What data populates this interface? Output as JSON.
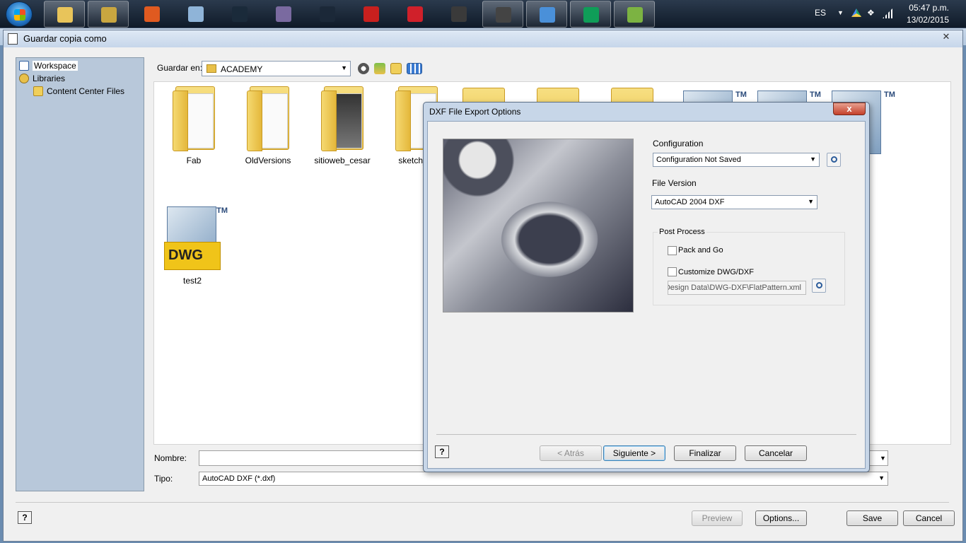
{
  "taskbar": {
    "apps": [
      {
        "name": "explorer",
        "color": "#e8c45a"
      },
      {
        "name": "inventor",
        "color": "#c9a640"
      },
      {
        "name": "matlab",
        "color": "#e05a20"
      },
      {
        "name": "atom",
        "color": "#8fb4d8"
      },
      {
        "name": "p-app",
        "color": "#1a2a3a"
      },
      {
        "name": "equalizer",
        "color": "#7a6aa0"
      },
      {
        "name": "steam",
        "color": "#1b2838"
      },
      {
        "name": "autocad",
        "color": "#c8201e"
      },
      {
        "name": "mplab",
        "color": "#d0202a"
      },
      {
        "name": "sublime",
        "color": "#3a3a3a"
      },
      {
        "name": "inkscape",
        "color": "#444"
      },
      {
        "name": "chrome",
        "color": "#4a90d9"
      },
      {
        "name": "hangouts",
        "color": "#0f9d58"
      },
      {
        "name": "green-app",
        "color": "#7cb342"
      }
    ],
    "lang": "ES",
    "time": "05:47 p.m.",
    "date": "13/02/2015"
  },
  "main": {
    "title": "Guardar copia como",
    "close_label": "✕",
    "sidebar": {
      "items": [
        {
          "label": "Workspace"
        },
        {
          "label": "Libraries"
        },
        {
          "label": "Content Center Files"
        }
      ]
    },
    "lookin_label": "Guardar en:",
    "lookin_value": "ACADEMY",
    "files": [
      {
        "name": "Fab",
        "kind": "folder"
      },
      {
        "name": "OldVersions",
        "kind": "folder"
      },
      {
        "name": "sitioweb_cesar",
        "kind": "folder"
      },
      {
        "name": "sketch_fe",
        "kind": "folder"
      },
      {
        "name": "test2",
        "kind": "dwg"
      }
    ],
    "dwg_text": "DWG",
    "dwg_tm": "TM",
    "name_label": "Nombre:",
    "name_value": "",
    "type_label": "Tipo:",
    "type_value": "AutoCAD DXF (*.dxf)",
    "help_label": "?",
    "buttons": {
      "preview": "Preview",
      "options": "Options...",
      "save": "Save",
      "cancel": "Cancel"
    }
  },
  "dxf": {
    "title": "DXF File Export Options",
    "close_label": "x",
    "configuration_label": "Configuration",
    "configuration_value": "Configuration Not Saved",
    "file_version_label": "File Version",
    "file_version_value": "AutoCAD 2004 DXF",
    "post_process_label": "Post Process",
    "pack_and_go_label": "Pack and Go",
    "pack_and_go_checked": false,
    "customize_label": "Customize DWG/DXF",
    "customize_checked": false,
    "customize_path": "Design Data\\DWG-DXF\\FlatPattern.xml",
    "help_label": "?",
    "buttons": {
      "back": "< Atrás",
      "next": "Siguiente >",
      "finish": "Finalizar",
      "cancel": "Cancelar"
    }
  }
}
